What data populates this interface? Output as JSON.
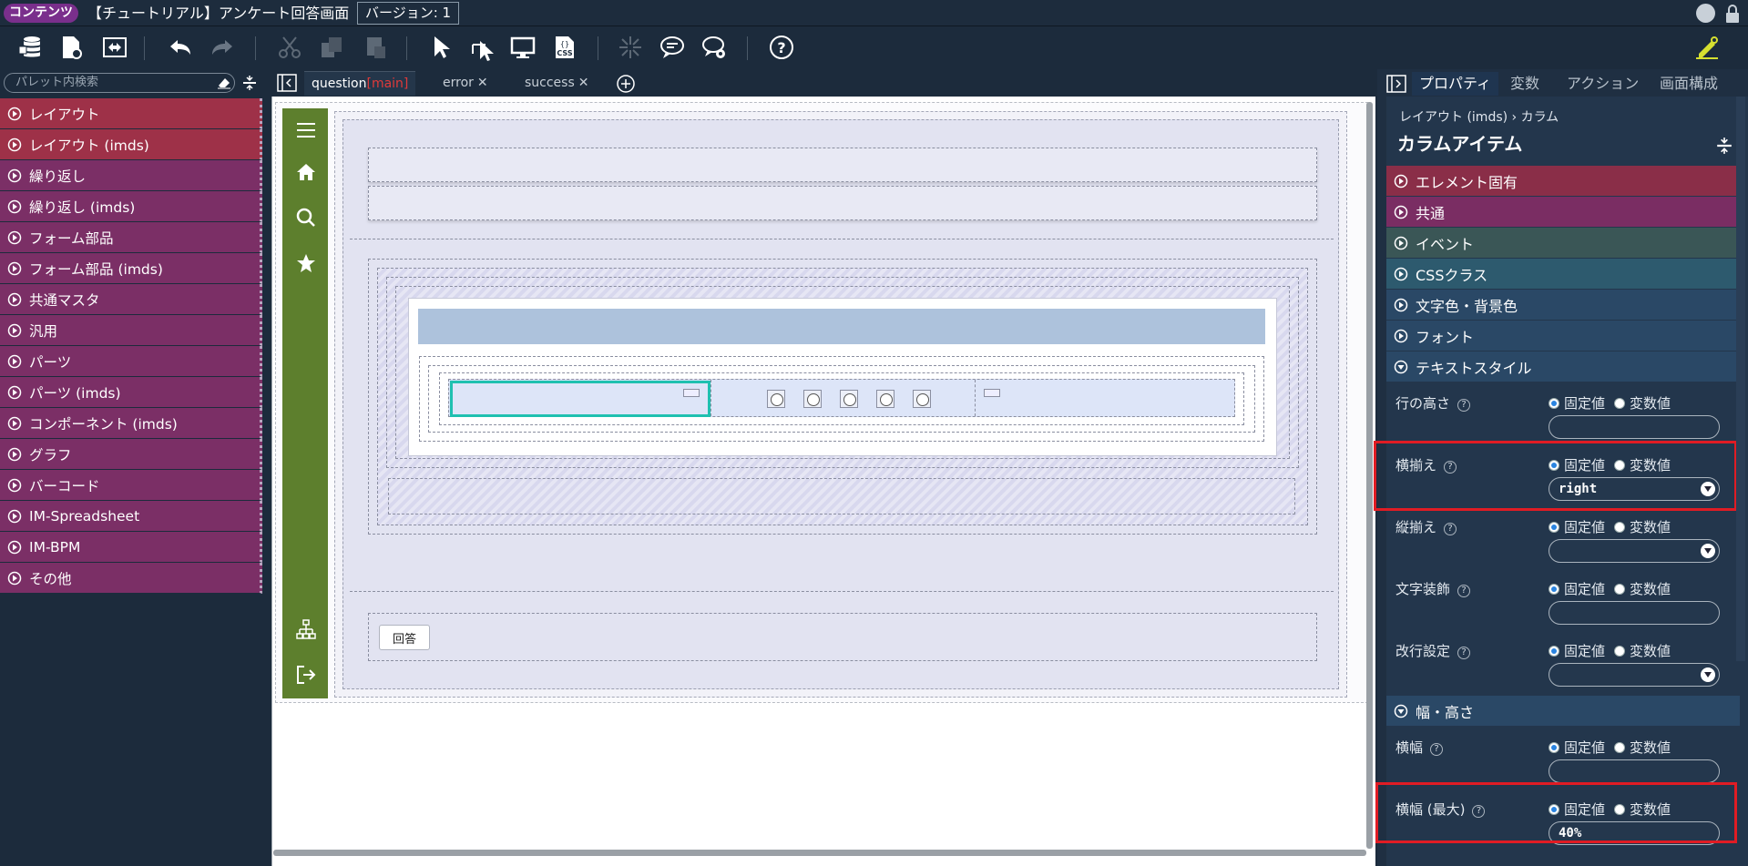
{
  "title_bar": {
    "badge": "コンテンツ",
    "page_name": "【チュートリアル】アンケート回答画面",
    "version": "バージョン: 1"
  },
  "toolbar": {
    "icons": [
      "database-stack-icon",
      "file-settings-icon",
      "swap-icon",
      "undo-icon",
      "redo-icon",
      "cut-icon",
      "copy-icon",
      "paste-icon",
      "select-arrow-icon",
      "pointer-cursor-icon",
      "monitor-icon",
      "css-icon",
      "sparkle-icon",
      "comment-icon",
      "comment-settings-icon",
      "help-icon",
      "edit-pencil-icon"
    ]
  },
  "palette": {
    "search_placeholder": "パレット内検索",
    "items": [
      {
        "label": "レイアウト",
        "color": "#9e3148"
      },
      {
        "label": "レイアウト (imds)",
        "color": "#9e3148"
      },
      {
        "label": "繰り返し",
        "color": "#7b2f66"
      },
      {
        "label": "繰り返し (imds)",
        "color": "#7b2f66"
      },
      {
        "label": "フォーム部品",
        "color": "#7b2f66"
      },
      {
        "label": "フォーム部品 (imds)",
        "color": "#7b2f66"
      },
      {
        "label": "共通マスタ",
        "color": "#7b2f66"
      },
      {
        "label": "汎用",
        "color": "#7b2f66"
      },
      {
        "label": "パーツ",
        "color": "#7b2f66"
      },
      {
        "label": "パーツ (imds)",
        "color": "#7b2f66"
      },
      {
        "label": "コンポーネント (imds)",
        "color": "#7b2f66"
      },
      {
        "label": "グラフ",
        "color": "#7b2f66"
      },
      {
        "label": "バーコード",
        "color": "#7b2f66"
      },
      {
        "label": "IM-Spreadsheet",
        "color": "#7b2f66"
      },
      {
        "label": "IM-BPM",
        "color": "#7b2f66"
      },
      {
        "label": "その他",
        "color": "#7b2f66"
      }
    ]
  },
  "tabs": {
    "active": {
      "name": "question",
      "tag": "[main]"
    },
    "others": [
      "error",
      "success"
    ]
  },
  "canvas": {
    "answer_button": "回答",
    "radio_count": 5
  },
  "right_panel": {
    "tabs": [
      "プロパティ",
      "変数",
      "アクション",
      "画面構成"
    ],
    "breadcrumb": "レイアウト (imds)  › カラム",
    "title": "カラムアイテム",
    "sections": [
      {
        "label": "エレメント固有",
        "color": "#8a2e48"
      },
      {
        "label": "共通",
        "color": "#7a2d63"
      },
      {
        "label": "イベント",
        "color": "#3a5656"
      },
      {
        "label": "CSSクラス",
        "color": "#2d5a6e"
      },
      {
        "label": "文字色・背景色",
        "color": "#2a4866"
      },
      {
        "label": "フォント",
        "color": "#2a4866"
      },
      {
        "label": "テキストスタイル",
        "color": "#2a4866"
      }
    ],
    "radio_fixed": "固定値",
    "radio_variable": "変数値",
    "text_style_props": [
      {
        "label": "行の高さ",
        "value": "",
        "select": false
      },
      {
        "label": "横揃え",
        "value": "right",
        "select": true
      },
      {
        "label": "縦揃え",
        "value": "",
        "select": true
      },
      {
        "label": "文字装飾",
        "value": "",
        "select": false
      },
      {
        "label": "改行設定",
        "value": "",
        "select": true
      }
    ],
    "size_section": {
      "label": "幅・高さ",
      "color": "#2a4866"
    },
    "size_props": [
      {
        "label": "横幅",
        "value": ""
      },
      {
        "label": "横幅 (最大)",
        "value": "40%"
      }
    ]
  }
}
